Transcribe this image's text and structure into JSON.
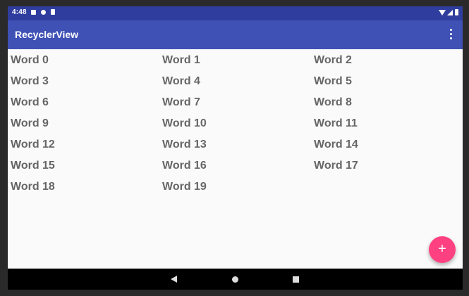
{
  "status_bar": {
    "time": "4:48"
  },
  "app_bar": {
    "title": "RecyclerView"
  },
  "list": {
    "items": [
      "Word 0",
      "Word 1",
      "Word 2",
      "Word 3",
      "Word 4",
      "Word 5",
      "Word 6",
      "Word 7",
      "Word 8",
      "Word 9",
      "Word 10",
      "Word 11",
      "Word 12",
      "Word 13",
      "Word 14",
      "Word 15",
      "Word 16",
      "Word 17",
      "Word 18",
      "Word 19"
    ]
  },
  "fab": {
    "label": "+",
    "color": "#ff4081"
  },
  "colors": {
    "app_bar": "#3f51b5",
    "status_bar": "#2f3e9e",
    "background": "#fafafa"
  },
  "icons": {
    "notification_icons": [
      "notification-a-icon",
      "notification-b-icon",
      "sd-card-icon"
    ],
    "status": [
      "wifi-icon",
      "signal-icon",
      "battery-icon"
    ],
    "nav": [
      "back-icon",
      "home-icon",
      "recents-icon"
    ],
    "menu": "overflow-menu-icon"
  }
}
